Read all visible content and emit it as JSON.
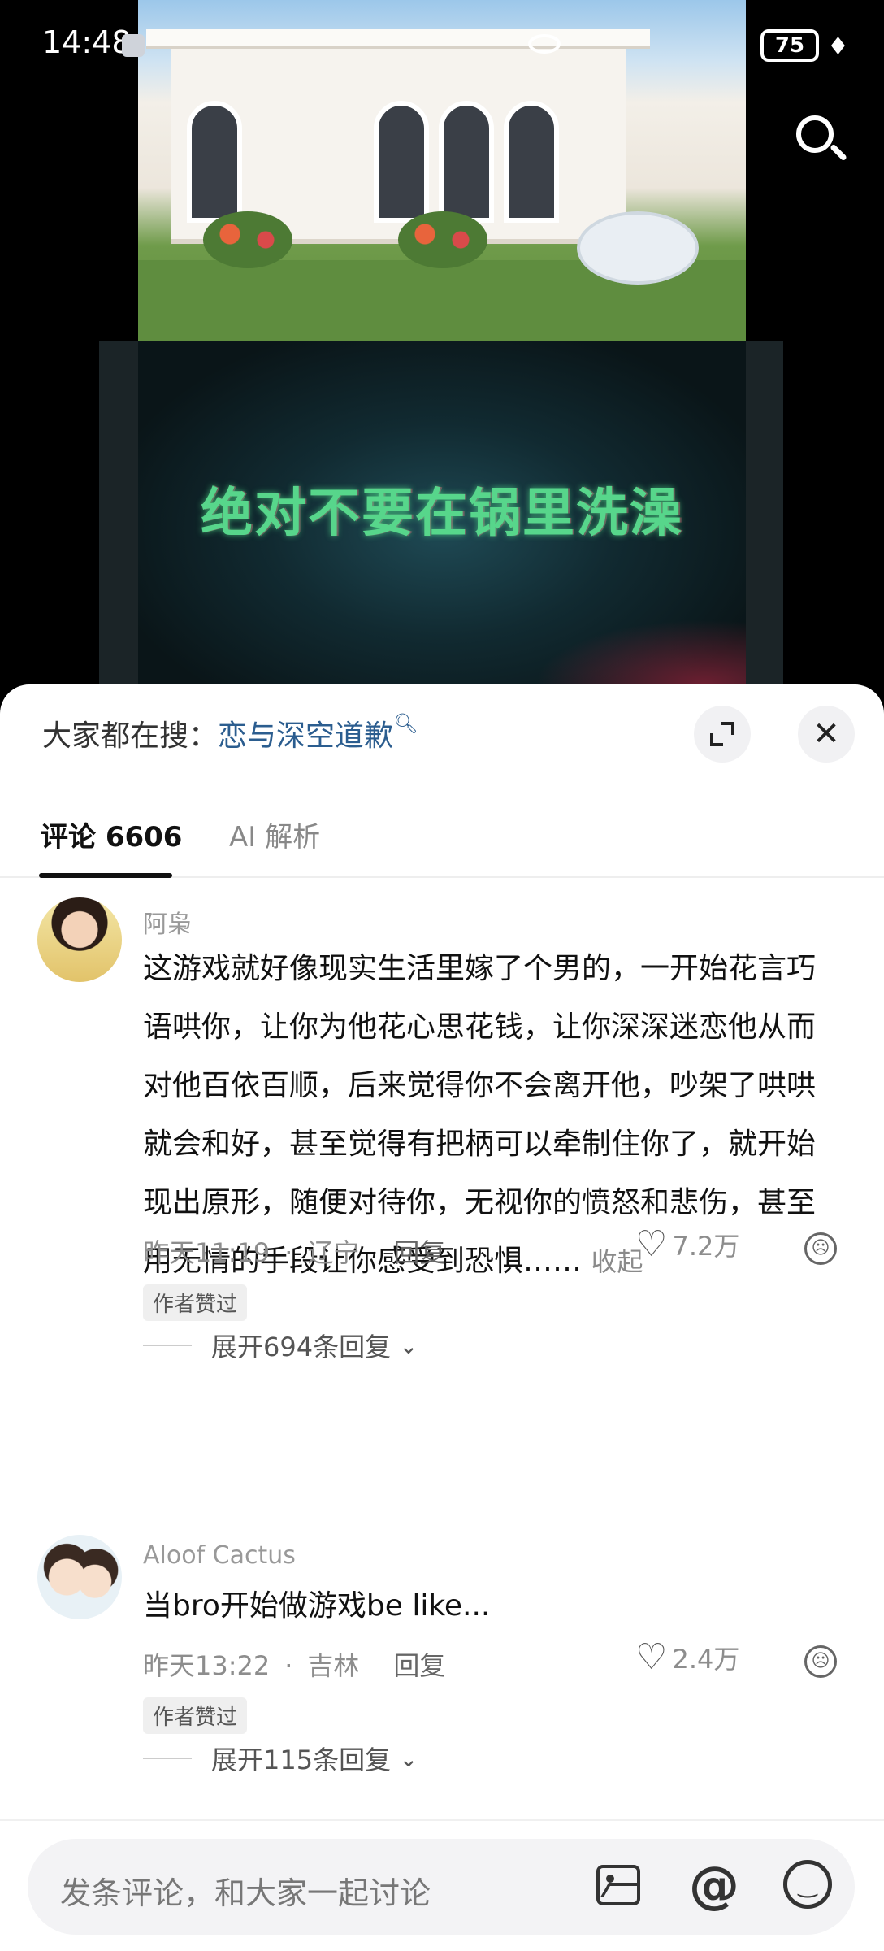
{
  "status_bar": {
    "time": "14:48",
    "battery": "75"
  },
  "video": {
    "headline": "绝对不要在锅里洗澡"
  },
  "sheet": {
    "hot_search_prefix": "大家都在搜：",
    "hot_search_keyword": "恋与深空道歉",
    "tabs": [
      {
        "label": "评论 6606",
        "active": true
      },
      {
        "label": "AI 解析",
        "active": false
      }
    ]
  },
  "comments": [
    {
      "user": "阿枭",
      "text": "这游戏就好像现实生活里嫁了个男的，一开始花言巧语哄你，让你为他花心思花钱，让你深深迷恋他从而对他百依百顺，后来觉得你不会离开他，吵架了哄哄就会和好，甚至觉得有把柄可以牵制住你了，就开始现出原形，随便对待你，无视你的愤怒和悲伤，甚至用无情的手段让你感受到恐惧……",
      "collapse_label": "收起",
      "time": "昨天11:19",
      "location": "辽宁",
      "reply_label": "回复",
      "likes": "7.2万",
      "badge": "作者赞过",
      "expand_replies": "展开694条回复"
    },
    {
      "user": "Aloof Cactus",
      "text": "当bro开始做游戏be like...",
      "time": "昨天13:22",
      "location": "吉林",
      "reply_label": "回复",
      "likes": "2.4万",
      "badge": "作者赞过",
      "expand_replies": "展开115条回复"
    }
  ],
  "input": {
    "placeholder": "发条评论，和大家一起讨论"
  }
}
